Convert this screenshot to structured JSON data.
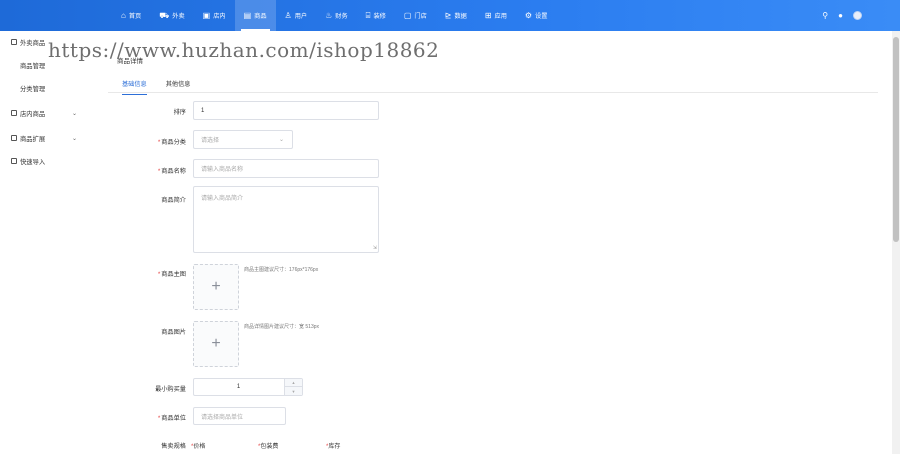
{
  "topnav": {
    "items": [
      {
        "label": "首页",
        "icon": "home-icon",
        "glyph": "⌂"
      },
      {
        "label": "外卖",
        "icon": "delivery-icon",
        "glyph": "⛟"
      },
      {
        "label": "店内",
        "icon": "store-icon",
        "glyph": "▣"
      },
      {
        "label": "商品",
        "icon": "goods-icon",
        "glyph": "▤"
      },
      {
        "label": "用户",
        "icon": "user-icon",
        "glyph": "♙"
      },
      {
        "label": "财务",
        "icon": "finance-icon",
        "glyph": "♨"
      },
      {
        "label": "装修",
        "icon": "decorate-icon",
        "glyph": "⌸"
      },
      {
        "label": "门店",
        "icon": "shop-icon",
        "glyph": "▢"
      },
      {
        "label": "数据",
        "icon": "chart-icon",
        "glyph": "⊵"
      },
      {
        "label": "应用",
        "icon": "apps-icon",
        "glyph": "⊞"
      },
      {
        "label": "设置",
        "icon": "gear-icon",
        "glyph": "⚙"
      }
    ],
    "active_index": 3
  },
  "sidebar": {
    "group1": "外卖商品",
    "sub1": "商品管理",
    "sub2": "分类管理",
    "group2": "店内商品",
    "group3": "商品扩展",
    "group4": "快速导入"
  },
  "watermark": "https://www.huzhan.com/ishop18862",
  "page_title": "商品详情",
  "tabs": [
    "基础信息",
    "其他信息"
  ],
  "form": {
    "sort_label": "排序",
    "sort_value": "1",
    "category_label": "商品分类",
    "category_placeholder": "请选择",
    "name_label": "商品名称",
    "name_placeholder": "请输入商品名称",
    "intro_label": "商品简介",
    "intro_placeholder": "请输入商品简介",
    "main_image_label": "商品主图",
    "main_image_hint": "商品主图建议尺寸：176px*176px",
    "images_label": "商品图片",
    "images_hint": "商品详情图片建议尺寸：宽 513px",
    "min_buy_label": "最小购买量",
    "min_buy_value": "1",
    "unit_label": "商品单位",
    "unit_placeholder": "请选择商品单位",
    "spec_label": "售卖规格",
    "spec_columns": [
      "价格",
      "包装费",
      "库存"
    ]
  }
}
